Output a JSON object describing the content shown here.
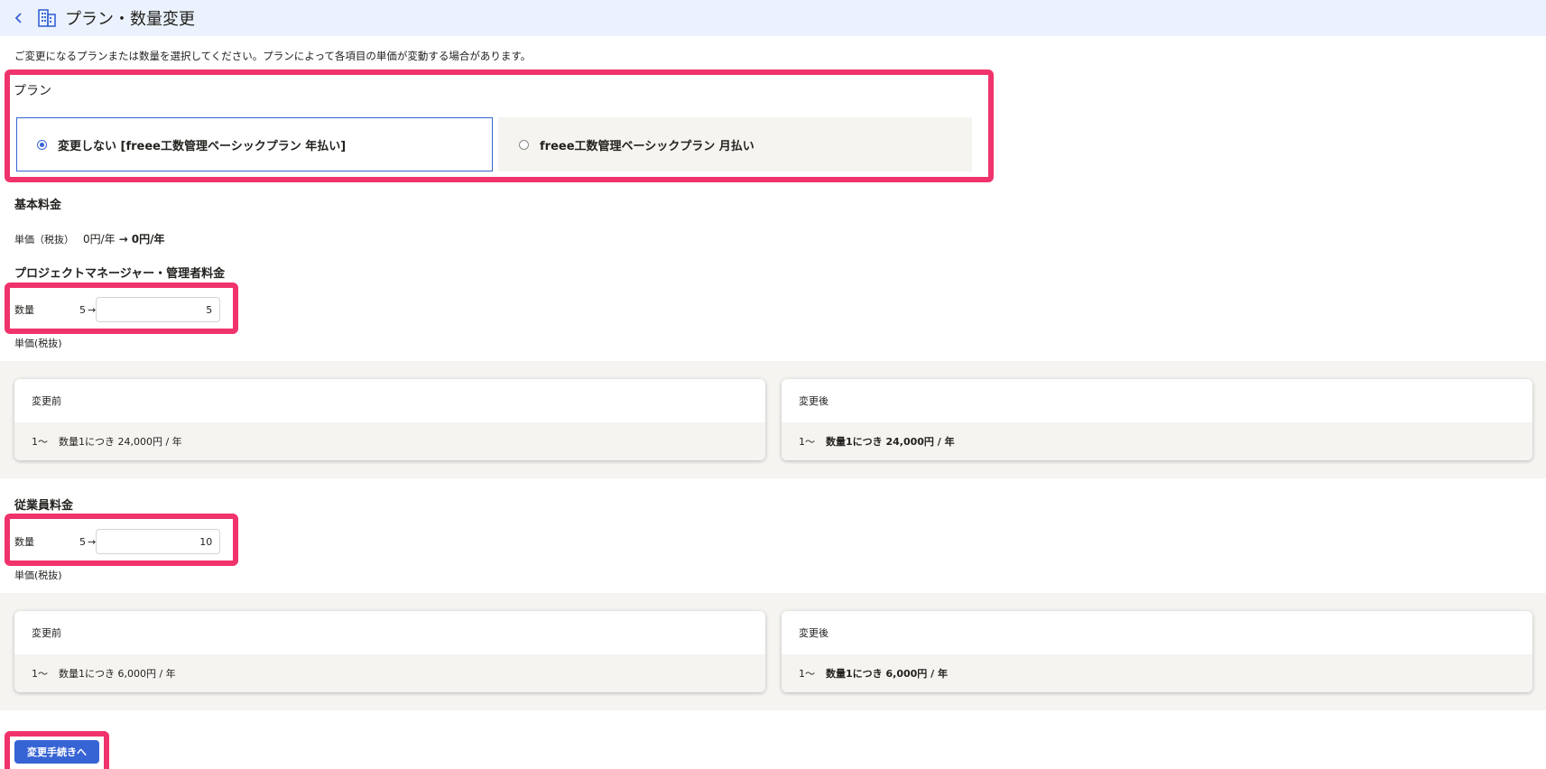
{
  "header": {
    "back_icon": "chevron-left-icon",
    "page_icon": "building-icon",
    "title": "プラン・数量変更"
  },
  "description": "ご変更になるプランまたは数量を選択してください。プランによって各項目の単価が変動する場合があります。",
  "plan": {
    "label": "プラン",
    "options": [
      {
        "label": "変更しない [freee工数管理ベーシックプラン 年払い]",
        "selected": true
      },
      {
        "label": "freee工数管理ベーシックプラン 月払い",
        "selected": false
      }
    ]
  },
  "base_fee": {
    "title": "基本料金",
    "unit_price_label": "単価（税抜）",
    "before": "0円/年",
    "arrow": "→",
    "after": "0円/年"
  },
  "pm_fee": {
    "title": "プロジェクトマネージャー・管理者料金",
    "quantity_label": "数量",
    "current_quantity": "5",
    "arrow": "→",
    "new_quantity": "5",
    "unit_price_label": "単価(税抜)",
    "before_card": {
      "title": "変更前",
      "range": "1～",
      "text": "数量1につき 24,000円 / 年"
    },
    "after_card": {
      "title": "変更後",
      "range": "1～",
      "text": "数量1につき 24,000円 / 年"
    }
  },
  "employee_fee": {
    "title": "従業員料金",
    "quantity_label": "数量",
    "current_quantity": "5",
    "arrow": "→",
    "new_quantity": "10",
    "unit_price_label": "単価(税抜)",
    "before_card": {
      "title": "変更前",
      "range": "1～",
      "text": "数量1につき 6,000円 / 年"
    },
    "after_card": {
      "title": "変更後",
      "range": "1～",
      "text": "数量1につき 6,000円 / 年"
    }
  },
  "submit_label": "変更手続きへ",
  "colors": {
    "accent": "#3764d4",
    "highlight": "#f0336c",
    "header_bg": "#ebf2fd",
    "band_bg": "#f5f4f1"
  }
}
